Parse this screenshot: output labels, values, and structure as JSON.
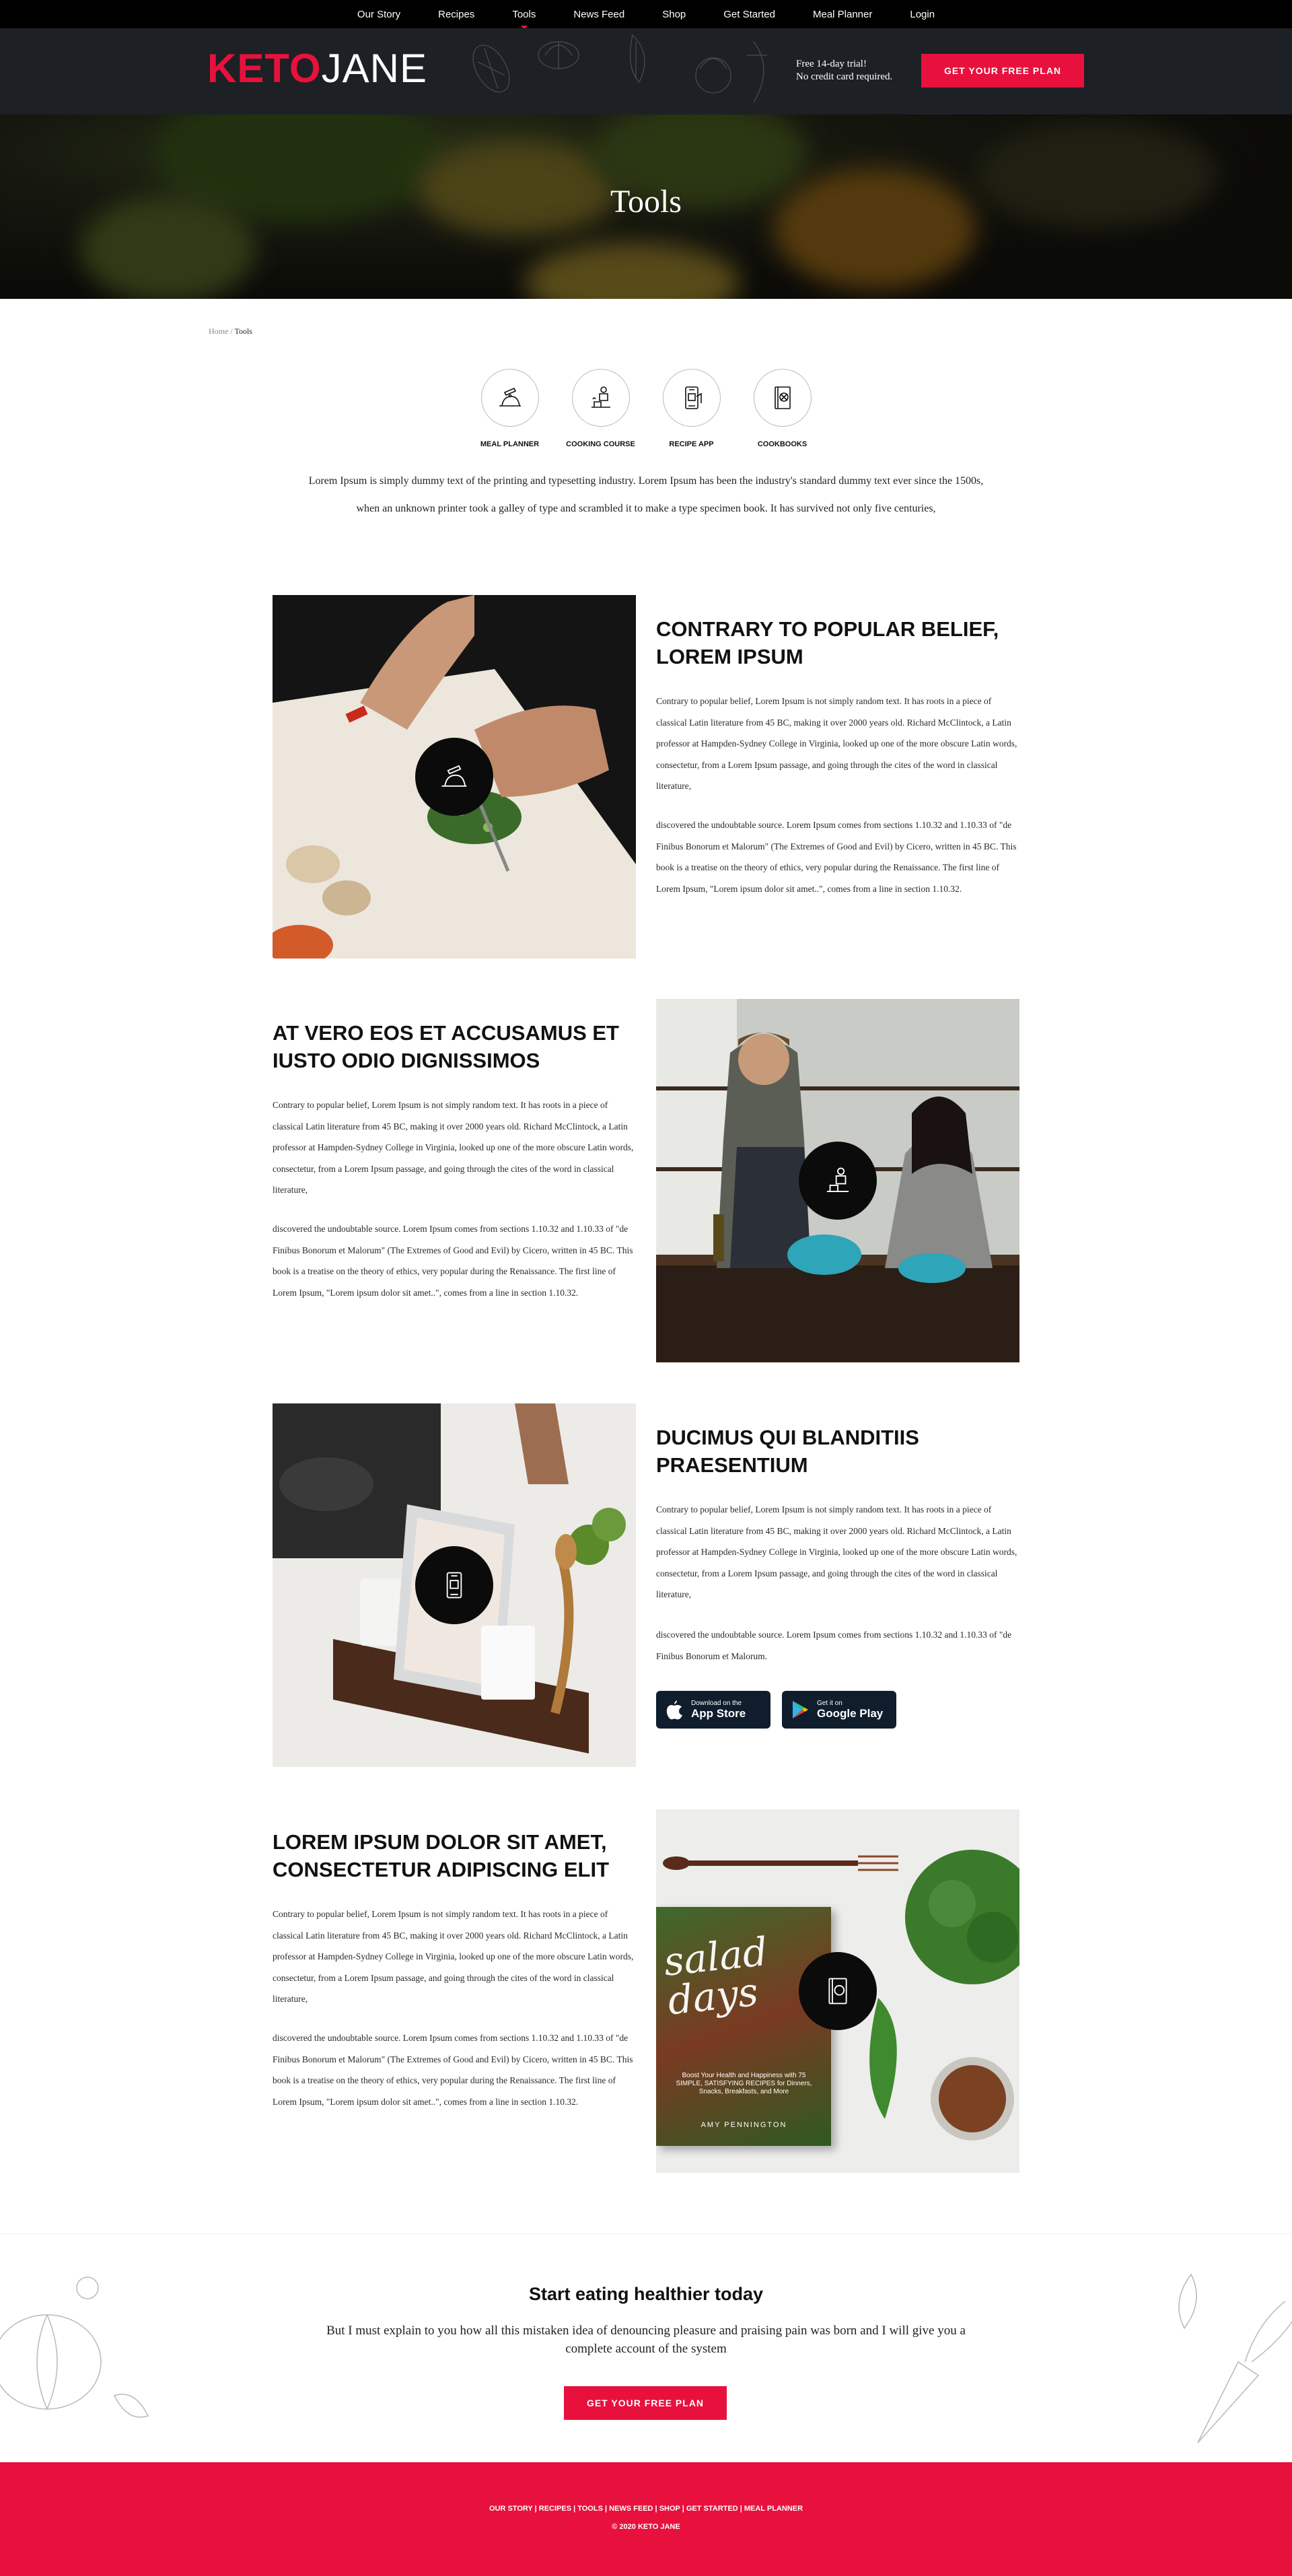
{
  "nav": {
    "items": [
      "Our Story",
      "Recipes",
      "Tools",
      "News Feed",
      "Shop",
      "Get Started",
      "Meal Planner",
      "Login"
    ],
    "active": "Tools"
  },
  "header": {
    "logo_keto": "KETO",
    "logo_jane": "JANE",
    "trial_line1": "Free 14-day trial!",
    "trial_line2": "No credit card required.",
    "cta_label": "GET YOUR FREE PLAN"
  },
  "hero": {
    "title": "Tools"
  },
  "breadcrumb": {
    "home": "Home",
    "separator": "/",
    "current": "Tools"
  },
  "tools": [
    {
      "label": "MEAL PLANNER",
      "icon": "meal-planner-icon"
    },
    {
      "label": "COOKING COURSE",
      "icon": "cooking-course-icon"
    },
    {
      "label": "RECIPE APP",
      "icon": "recipe-app-icon"
    },
    {
      "label": "COOKBOOKS",
      "icon": "cookbook-icon"
    }
  ],
  "intro": "Lorem Ipsum is simply dummy text of the printing and typesetting industry. Lorem Ipsum has been the industry's standard dummy text ever since the 1500s, when an unknown printer took a galley of type and scrambled it to make a type specimen book. It has survived not only five centuries,",
  "sections": [
    {
      "title": "CONTRARY TO POPULAR BELIEF, LOREM IPSUM",
      "p1": "Contrary to popular belief, Lorem Ipsum is not simply random text. It has roots in a piece of classical Latin literature from 45 BC, making it over 2000 years old. Richard McClintock, a Latin professor at Hampden-Sydney College in Virginia, looked up one of the more obscure Latin words, consectetur, from a Lorem Ipsum passage, and going through the cites of the word in classical literature,",
      "p2": "discovered the undoubtable source. Lorem Ipsum comes from sections 1.10.32 and 1.10.33 of \"de Finibus Bonorum et Malorum\" (The Extremes of Good and Evil) by Cicero, written in 45 BC. This book is a treatise on the theory of ethics, very popular during the Renaissance. The first line of Lorem Ipsum, \"Lorem ipsum dolor sit amet..\", comes from a line in section 1.10.32."
    },
    {
      "title": "AT VERO EOS ET ACCUSAMUS ET IUSTO ODIO DIGNISSIMOS",
      "p1": "Contrary to popular belief, Lorem Ipsum is not simply random text. It has roots in a piece of classical Latin literature from 45 BC, making it over 2000 years old. Richard McClintock, a Latin professor at Hampden-Sydney College in Virginia, looked up one of the more obscure Latin words, consectetur, from a Lorem Ipsum passage, and going through the cites of the word in classical literature,",
      "p2": "discovered the undoubtable source. Lorem Ipsum comes from sections 1.10.32 and 1.10.33 of \"de Finibus Bonorum et Malorum\" (The Extremes of Good and Evil) by Cicero, written in 45 BC. This book is a treatise on the theory of ethics, very popular during the Renaissance. The first line of Lorem Ipsum, \"Lorem ipsum dolor sit amet..\", comes from a line in section 1.10.32."
    },
    {
      "title": "DUCIMUS QUI BLANDITIIS PRAESENTIUM",
      "p1": "Contrary to popular belief, Lorem Ipsum is not simply random text. It has roots in a piece of classical Latin literature from 45 BC, making it over 2000 years old. Richard McClintock, a Latin professor at Hampden-Sydney College in Virginia, looked up one of the more obscure Latin words, consectetur, from a Lorem Ipsum passage, and going through the cites of the word in classical literature,",
      "p2": "discovered the undoubtable source. Lorem Ipsum comes from sections 1.10.32 and 1.10.33 of \"de Finibus Bonorum et Malorum.",
      "appstore_small": "Download on the",
      "appstore_big": "App Store",
      "googleplay_small": "Get it on",
      "googleplay_big": "Google Play"
    },
    {
      "title": "LOREM IPSUM DOLOR SIT AMET, CONSECTETUR ADIPISCING ELIT",
      "p1": "Contrary to popular belief, Lorem Ipsum is not simply random text. It has roots in a piece of classical Latin literature from 45 BC, making it over 2000 years old. Richard McClintock, a Latin professor at Hampden-Sydney College in Virginia, looked up one of the more obscure Latin words, consectetur, from a Lorem Ipsum passage, and going through the cites of the word in classical literature,",
      "p2": "discovered the undoubtable source. Lorem Ipsum comes from sections 1.10.32 and 1.10.33 of \"de Finibus Bonorum et Malorum\" (The Extremes of Good and Evil) by Cicero, written in 45 BC. This book is a treatise on the theory of ethics, very popular during the Renaissance. The first line of Lorem Ipsum, \"Lorem ipsum dolor sit amet..\", comes from a line in section 1.10.32.",
      "book_title": "salad days",
      "book_subtitle": "Boost Your Health and Happiness with 75 SIMPLE, SATISFYING RECIPES for Dinners, Snacks, Breakfasts, and More",
      "book_author": "AMY PENNINGTON"
    }
  ],
  "cta": {
    "title": "Start eating healthier today",
    "text": "But I must explain to you how all this mistaken idea of denouncing pleasure and praising pain was born and I will give you a complete account of the system",
    "button": "GET YOUR FREE PLAN"
  },
  "footer": {
    "links": "OUR STORY | RECIPES | TOOLS | NEWS FEED | SHOP | GET STARTED | MEAL PLANNER",
    "copyright": "© 2020 KETO JANE"
  },
  "colors": {
    "accent": "#e8113d",
    "header_bg": "#1d2024",
    "store_bg": "#0f1d2c"
  }
}
